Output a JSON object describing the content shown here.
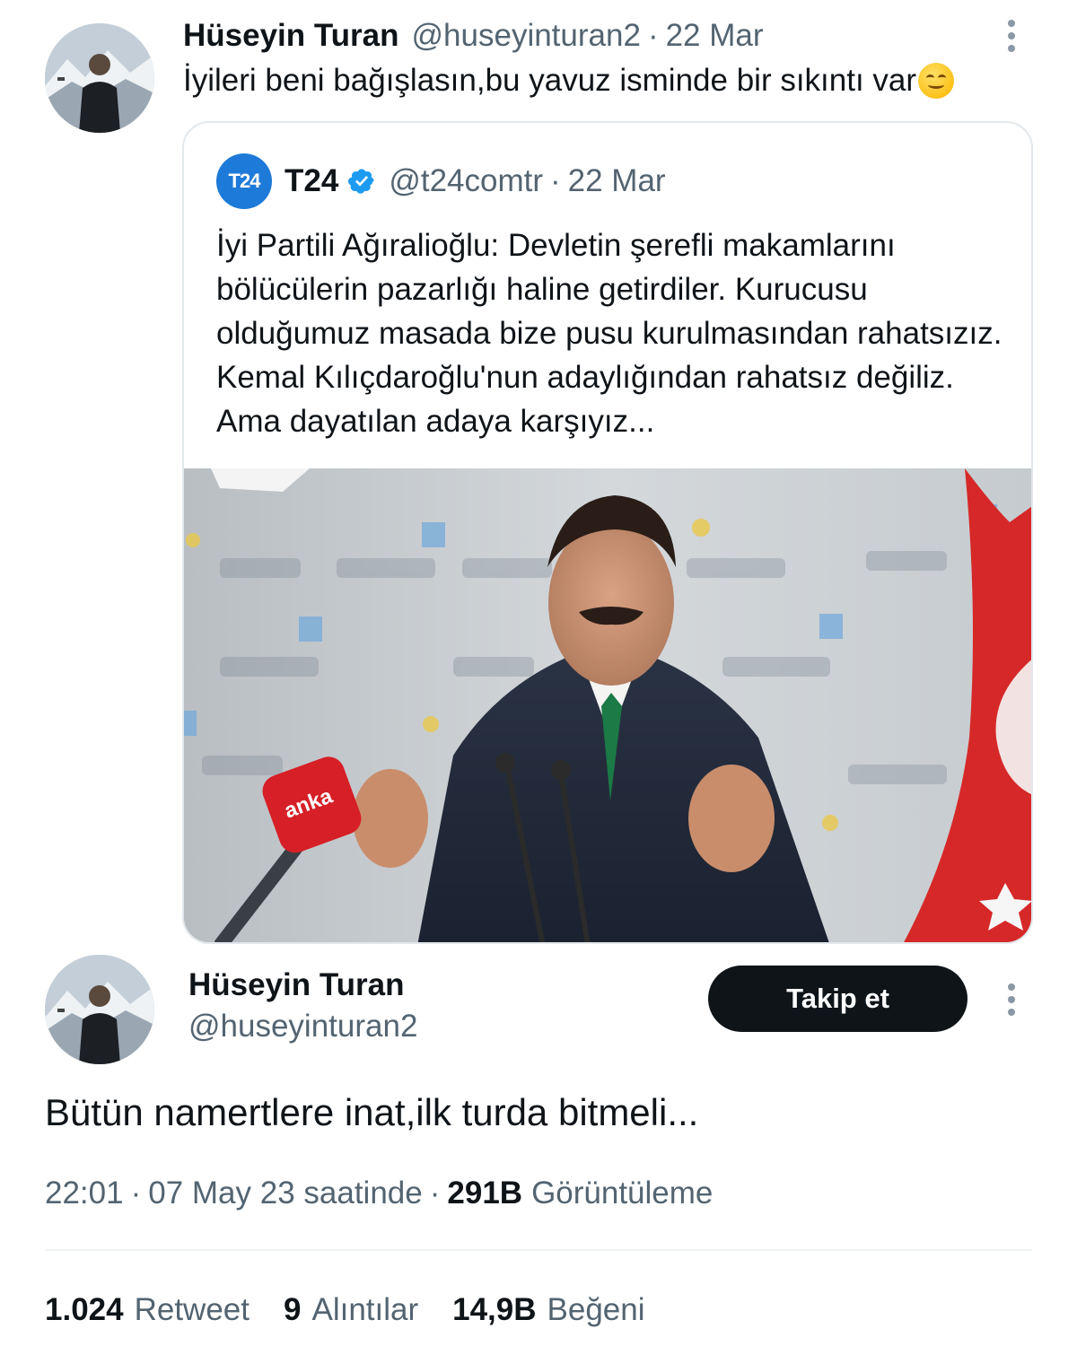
{
  "reply_tweet": {
    "author_name": "Hüseyin Turan",
    "author_handle": "@huseyinturan2",
    "separator": "·",
    "date": "22 Mar",
    "text": "İyileri beni bağışlasın,bu yavuz isminde bir sıkıntı var",
    "emoji_icon": "smiling-face-emoji"
  },
  "quoted_tweet": {
    "logo_text": "T24",
    "author_name": "T24",
    "verified_icon": "verified-badge-icon",
    "author_handle": "@t24comtr",
    "separator": "·",
    "date": "22 Mar",
    "text": "İyi Partili Ağıralioğlu: Devletin şerefli makamlarını bölücülerin pazarlığı haline getirdiler. Kurucusu olduğumuz masada bize pusu kurulmasından rahatsızız. Kemal Kılıçdaroğlu'nun adaylığından rahatsız değiliz. Ama dayatılan adaya karşıyız...",
    "mic_label": "anka"
  },
  "main_tweet": {
    "author_name": "Hüseyin Turan",
    "author_handle": "@huseyinturan2",
    "follow_label": "Takip et",
    "text": "Bütün namertlere inat,ilk turda bitmeli...",
    "time": "22:01",
    "separator": "·",
    "date_text": "07 May 23 saatinde",
    "views_count": "291B",
    "views_label": "Görüntüleme",
    "stats": {
      "retweets_count": "1.024",
      "retweets_label": "Retweet",
      "quotes_count": "9",
      "quotes_label": "Alıntılar",
      "likes_count": "14,9B",
      "likes_label": "Beğeni"
    }
  },
  "colors": {
    "text_primary": "#0f1419",
    "text_secondary": "#536471",
    "verified": "#1d9bf0",
    "button_bg": "#0f1419",
    "t24_logo": "#1e7ad8"
  }
}
